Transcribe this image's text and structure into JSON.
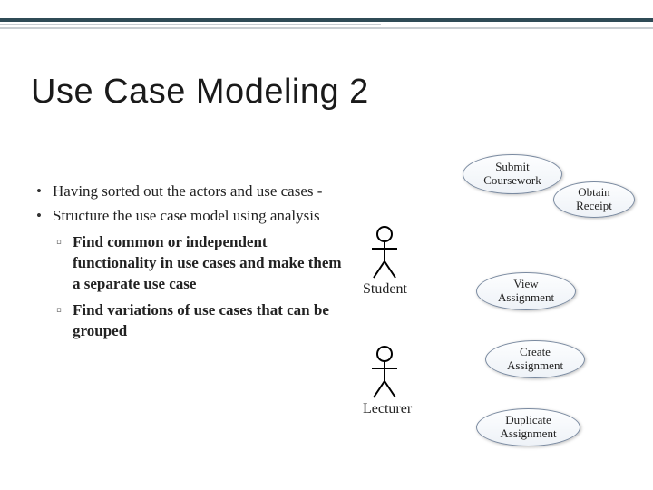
{
  "title": "Use Case Modeling 2",
  "bullets": {
    "b1": "Having sorted out the actors and use cases -",
    "b2": "Structure the use case model using analysis",
    "sub1": "Find common or independent functionality in use cases and make them a separate use case",
    "sub2": "Find variations of use cases that can be grouped"
  },
  "actors": {
    "student": "Student",
    "lecturer": "Lecturer"
  },
  "usecases": {
    "submit": "Submit Coursework",
    "obtain": "Obtain Receipt",
    "view": "View Assignment",
    "create": "Create Assignment",
    "duplicate": "Duplicate Assignment"
  }
}
